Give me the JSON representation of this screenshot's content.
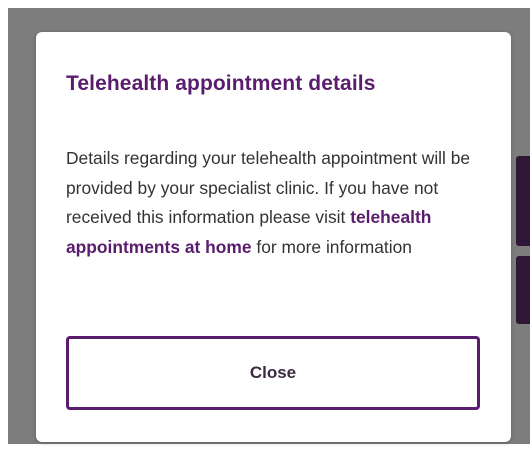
{
  "modal": {
    "title": "Telehealth appointment details",
    "body": {
      "text_before": "Details regarding your telehealth appointment will be provided by your specialist clinic. If you have not received this information please visit",
      "link_text": "telehealth appointments at home",
      "text_after": "for more information"
    },
    "close_label": "Close"
  },
  "colors": {
    "accent": "#5a1d6e",
    "overlay": "#7d7d7d",
    "body_text": "#333333"
  }
}
